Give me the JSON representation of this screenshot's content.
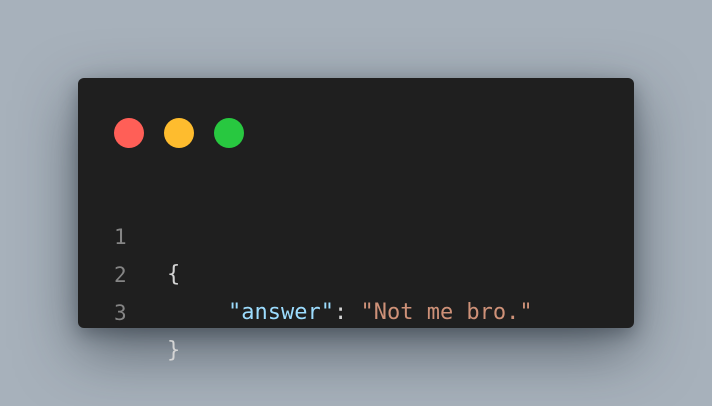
{
  "window": {
    "controls": [
      {
        "name": "close",
        "color": "#ff5f57"
      },
      {
        "name": "minimize",
        "color": "#febc2e"
      },
      {
        "name": "maximize",
        "color": "#28c840"
      }
    ]
  },
  "code": {
    "language": "json",
    "lines": [
      {
        "number": "1",
        "open_brace": "{"
      },
      {
        "number": "2",
        "key": "\"answer\"",
        "colon": ": ",
        "value": "\"Not me bro.\""
      },
      {
        "number": "3",
        "close_brace": "}"
      }
    ]
  },
  "theme": {
    "background": "#1f1f1f",
    "page_background": "#a7b1bb",
    "line_number_color": "#858585",
    "key_color": "#9cdcfe",
    "string_color": "#ce9178",
    "punctuation_color": "#d4d4d4"
  }
}
